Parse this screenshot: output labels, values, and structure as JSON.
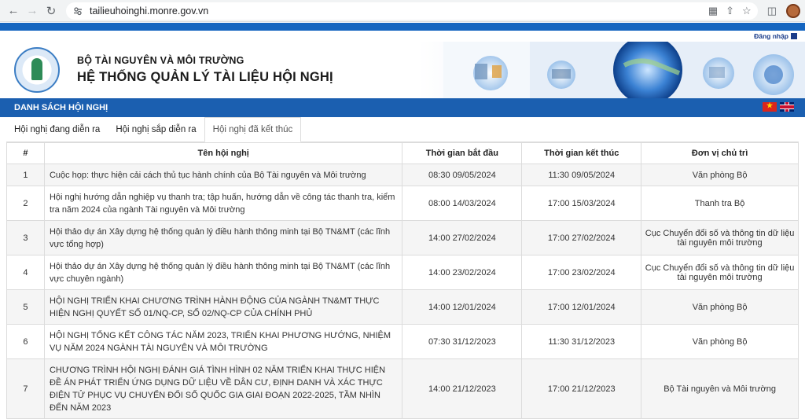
{
  "browser": {
    "url": "tailieuhoinghi.monre.gov.vn"
  },
  "header": {
    "login_label": "Đăng nhập",
    "line1": "BỘ TÀI NGUYÊN VÀ MÔI TRƯỜNG",
    "line2": "HỆ THỐNG QUẢN LÝ TÀI LIỆU HỘI NGHỊ"
  },
  "section_title": "DANH SÁCH HỘI NGHỊ",
  "languages": [
    "vi-flag",
    "en-flag"
  ],
  "tabs": [
    {
      "label": "Hội nghị đang diễn ra",
      "active": false
    },
    {
      "label": "Hội nghị sắp diễn ra",
      "active": false
    },
    {
      "label": "Hội nghị đã kết thúc",
      "active": true
    }
  ],
  "table": {
    "headers": [
      "#",
      "Tên hội nghị",
      "Thời gian bắt đầu",
      "Thời gian kết thúc",
      "Đơn vị chủ trì"
    ],
    "rows": [
      {
        "no": "1",
        "name": "Cuộc họp: thực hiện cải cách thủ tục hành chính của Bộ Tài nguyên và Môi trường",
        "start": "08:30 09/05/2024",
        "end": "11:30 09/05/2024",
        "unit": "Văn phòng Bộ"
      },
      {
        "no": "2",
        "name": "Hội nghị hướng dẫn nghiệp vụ thanh tra; tập huấn, hướng dẫn về công tác thanh tra, kiểm tra năm 2024 của ngành Tài nguyên và Môi trường",
        "start": "08:00 14/03/2024",
        "end": "17:00 15/03/2024",
        "unit": "Thanh tra Bộ"
      },
      {
        "no": "3",
        "name": "Hội thảo dự án Xây dựng hệ thống quản lý điều hành thông minh tại Bộ TN&MT (các lĩnh vực tổng hợp)",
        "start": "14:00 27/02/2024",
        "end": "17:00 27/02/2024",
        "unit": "Cục Chuyển đổi số và thông tin dữ liệu tài nguyên môi trường"
      },
      {
        "no": "4",
        "name": "Hội thảo dự án Xây dựng hệ thống quản lý điều hành thông minh tại Bộ TN&MT (các lĩnh vực chuyên ngành)",
        "start": "14:00 23/02/2024",
        "end": "17:00 23/02/2024",
        "unit": "Cục Chuyển đổi số và thông tin dữ liệu tài nguyên môi trường"
      },
      {
        "no": "5",
        "name": "HỘI NGHỊ TRIỂN KHAI CHƯƠNG TRÌNH HÀNH ĐỘNG CỦA NGÀNH TN&MT THỰC HIỆN NGHỊ QUYẾT SỐ 01/NQ-CP, SỐ 02/NQ-CP CỦA CHÍNH PHỦ",
        "start": "14:00 12/01/2024",
        "end": "17:00 12/01/2024",
        "unit": "Văn phòng Bộ"
      },
      {
        "no": "6",
        "name": "HỘI NGHỊ TỔNG KẾT CÔNG TÁC NĂM 2023, TRIỂN KHAI PHƯƠNG HƯỚNG, NHIỆM VỤ NĂM 2024 NGÀNH TÀI NGUYÊN VÀ MÔI TRƯỜNG",
        "start": "07:30 31/12/2023",
        "end": "11:30 31/12/2023",
        "unit": "Văn phòng Bộ"
      },
      {
        "no": "7",
        "name": "CHƯƠNG TRÌNH HỘI NGHỊ ĐÁNH GIÁ TÌNH HÌNH 02 NĂM TRIỂN KHAI THỰC HIỆN ĐỀ ÁN PHÁT TRIỂN ỨNG DỤNG DỮ LIỆU VỀ DÂN CƯ, ĐỊNH DANH VÀ XÁC THỰC ĐIỆN TỬ PHỤC VỤ CHUYỂN ĐỔI SỐ QUỐC GIA GIAI ĐOẠN 2022-2025, TẦM NHÌN ĐẾN NĂM 2023",
        "start": "14:00 21/12/2023",
        "end": "17:00 21/12/2023",
        "unit": "Bộ Tài nguyên và Môi trường"
      }
    ]
  }
}
